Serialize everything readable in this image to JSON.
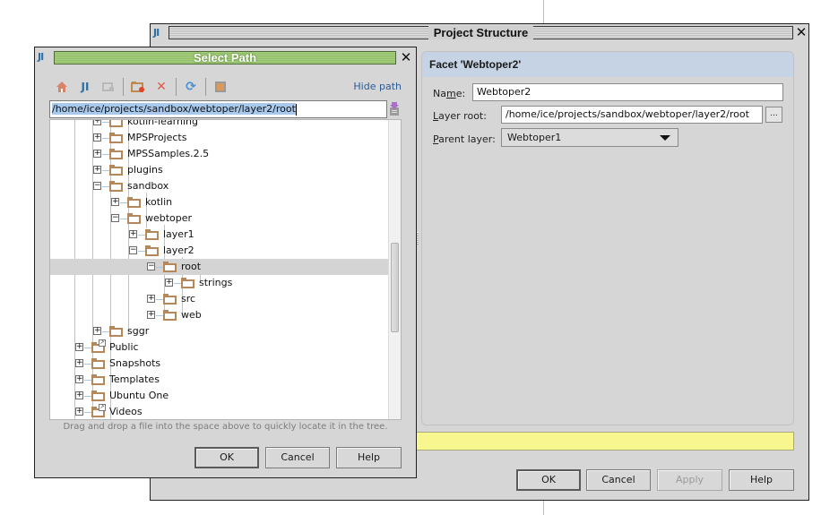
{
  "project_structure": {
    "title": "Project Structure",
    "facet_header": "Facet 'Webtoper2'",
    "name_label": "Name:",
    "name_value": "Webtoper2",
    "layer_root_label": "Layer root:",
    "layer_root_value": "/home/ice/projects/sandbox/webtoper/layer2/root",
    "browse_label": "...",
    "parent_layer_label": "Parent layer:",
    "parent_layer_value": "Webtoper1",
    "buttons": {
      "ok": "OK",
      "cancel": "Cancel",
      "apply": "Apply",
      "help": "Help"
    }
  },
  "select_path": {
    "title": "Select Path",
    "hide_path_label": "Hide path",
    "path_value": "/home/ice/projects/sandbox/webtoper/layer2/root",
    "toolbar_icons": [
      "home-icon",
      "project-icon",
      "module-icon",
      "new-folder-icon",
      "delete-icon",
      "refresh-icon",
      "show-hidden-icon"
    ],
    "tree": [
      {
        "label": "kotlin-learning",
        "expanded": false,
        "level": 3
      },
      {
        "label": "MPSProjects",
        "expanded": false,
        "level": 3
      },
      {
        "label": "MPSSamples.2.5",
        "expanded": false,
        "level": 3
      },
      {
        "label": "plugins",
        "expanded": false,
        "level": 3
      },
      {
        "label": "sandbox",
        "expanded": true,
        "level": 3
      },
      {
        "label": "kotlin",
        "expanded": false,
        "level": 4
      },
      {
        "label": "webtoper",
        "expanded": true,
        "level": 4
      },
      {
        "label": "layer1",
        "expanded": false,
        "level": 5
      },
      {
        "label": "layer2",
        "expanded": true,
        "level": 5
      },
      {
        "label": "root",
        "expanded": true,
        "level": 6,
        "selected": true
      },
      {
        "label": "strings",
        "expanded": false,
        "level": 7
      },
      {
        "label": "src",
        "expanded": false,
        "level": 6
      },
      {
        "label": "web",
        "expanded": false,
        "level": 6
      },
      {
        "label": "sggr",
        "expanded": false,
        "level": 3
      },
      {
        "label": "Public",
        "expanded": false,
        "level": 2,
        "link": true
      },
      {
        "label": "Snapshots",
        "expanded": false,
        "level": 2
      },
      {
        "label": "Templates",
        "expanded": false,
        "level": 2
      },
      {
        "label": "Ubuntu One",
        "expanded": false,
        "level": 2
      },
      {
        "label": "Videos",
        "expanded": false,
        "level": 2,
        "link": true
      }
    ],
    "hint": "Drag and drop a file into the space above to quickly locate it in the tree.",
    "buttons": {
      "ok": "OK",
      "cancel": "Cancel",
      "help": "Help"
    }
  }
}
